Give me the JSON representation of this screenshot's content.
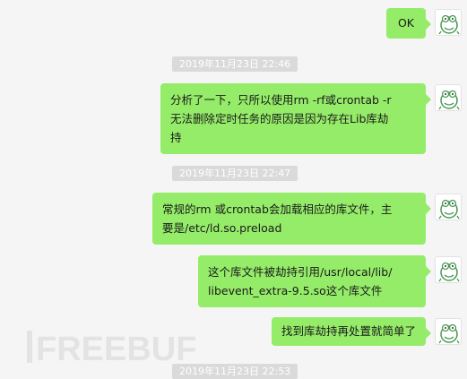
{
  "conversation": {
    "messages": [
      {
        "text": "OK"
      },
      {
        "timestamp": "2019年11月23日 22:46"
      },
      {
        "text": "分析了一下，只所以使用rm -rf或crontab -r\n无法删除定时任务的原因是因为存在Lib库劫\n持"
      },
      {
        "timestamp": "2019年11月23日 22:47"
      },
      {
        "text": "常规的rm 或crontab会加载相应的库文件，主\n要是/etc/ld.so.preload"
      },
      {
        "text": "这个库文件被劫持引用/usr/local/lib/\nlibevent_extra-9.5.so这个库文件"
      },
      {
        "text": "找到库劫持再处置就简单了"
      },
      {
        "timestamp": "2019年11月23日 22:53"
      }
    ]
  },
  "watermark": {
    "text": "FREEBUF"
  },
  "colors": {
    "background": "#f5f5f5",
    "sent_bubble": "#95ec69",
    "timestamp_bg": "#dadada",
    "timestamp_text": "#ffffff"
  },
  "icons": {
    "avatar": "cartoon-avatar-icon"
  }
}
